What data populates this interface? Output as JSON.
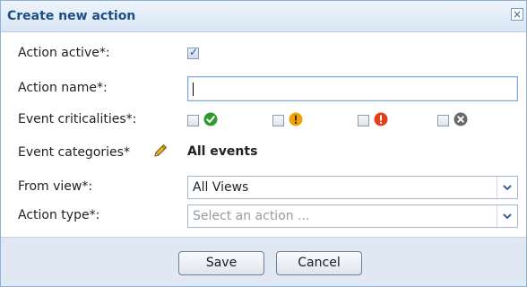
{
  "dialog": {
    "title": "Create new action",
    "close_glyph": "×"
  },
  "form": {
    "action_active": {
      "label": "Action active*:",
      "checked": true
    },
    "action_name": {
      "label": "Action name*:",
      "value": ""
    },
    "event_criticalities": {
      "label": "Event criticalities*:",
      "levels": [
        {
          "icon": "ok-green-icon",
          "color": "#2e9b2e",
          "checked": false
        },
        {
          "icon": "warning-orange-icon",
          "color": "#f0a000",
          "checked": false
        },
        {
          "icon": "error-red-icon",
          "color": "#e0401c",
          "checked": false
        },
        {
          "icon": "unknown-gray-icon",
          "color": "#6a6a6a",
          "checked": false
        }
      ]
    },
    "event_categories": {
      "label": "Event categories*",
      "value": "All events",
      "edit_icon": "pencil-icon"
    },
    "from_view": {
      "label": "From view*:",
      "selected": "All Views"
    },
    "action_type": {
      "label": "Action type*:",
      "placeholder": "Select an action ..."
    }
  },
  "buttons": {
    "save": "Save",
    "cancel": "Cancel"
  }
}
